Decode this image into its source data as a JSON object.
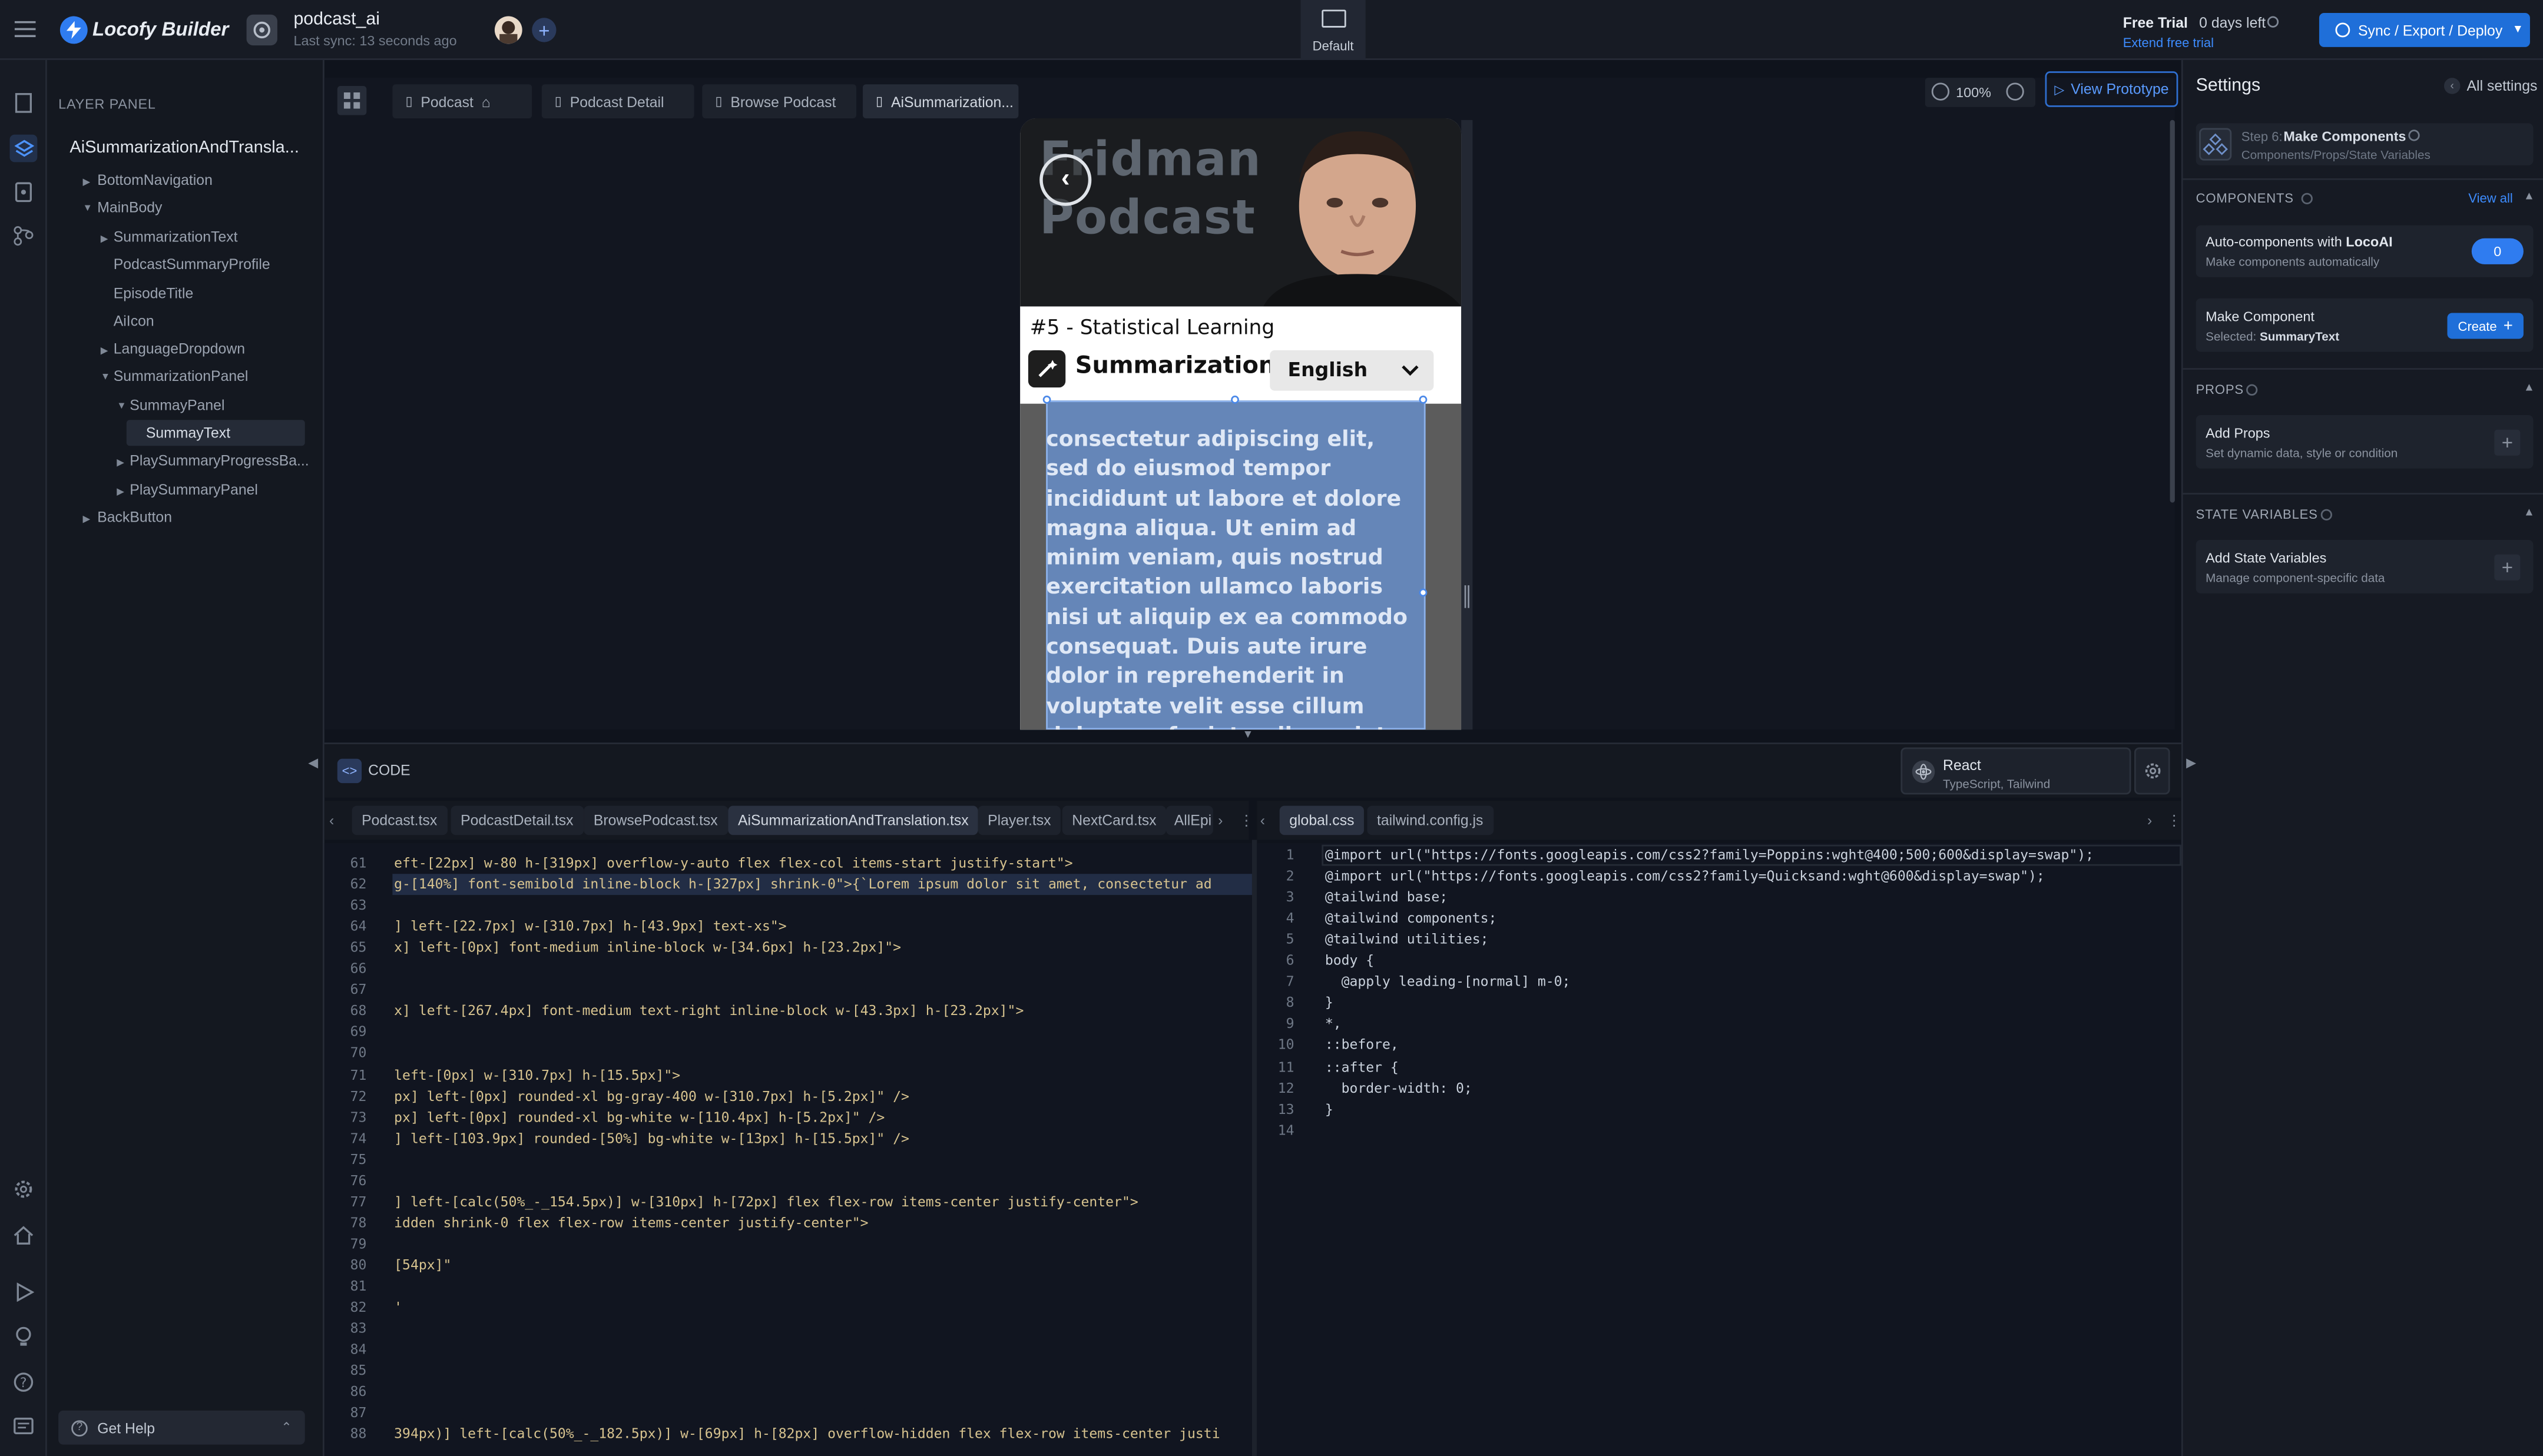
{
  "app": {
    "brand": "Locofy Builder",
    "project": "podcast_ai",
    "sync_status": "Last sync: 13 seconds ago",
    "device": "Default",
    "trial": "Free Trial",
    "days_left": "0 days left",
    "extend": "Extend free trial",
    "deploy": "Sync / Export / Deploy"
  },
  "layer_panel": {
    "title": "LAYER PANEL",
    "root": "AiSummarizationAndTransla...",
    "items": [
      "BottomNavigation",
      "MainBody",
      "SummarizationText",
      "PodcastSummaryProfile",
      "EpisodeTitle",
      "AiIcon",
      "LanguageDropdown",
      "SummarizationPanel",
      "SummayPanel",
      "SummayText",
      "PlaySummaryProgressBa...",
      "PlaySummaryPanel",
      "BackButton"
    ],
    "help": "Get Help"
  },
  "page_tabs": [
    "Podcast",
    "Podcast Detail",
    "Browse Podcast",
    "AiSummarization..."
  ],
  "zoom": "100%",
  "view_prototype": "View Prototype",
  "preview": {
    "header_line1": "Fridman",
    "header_line2": "Podcast",
    "episode": "#5 - Statistical Learning",
    "section": "Summarization",
    "language": "English",
    "body": "consectetur adipiscing elit, sed do eiusmod tempor incididunt ut labore et dolore magna aliqua. Ut enim ad minim veniam, quis nostrud exercitation ullamco laboris nisi ut aliquip ex ea commodo consequat. Duis aute irure dolor in reprehenderit in voluptate velit esse cillum dolore eu fugiat nulla pariatur. Excepteur"
  },
  "settings": {
    "title": "Settings",
    "all": "All settings",
    "step": "Step 6:",
    "step_title": "Make Components",
    "step_sub": "Components/Props/State Variables",
    "components_label": "COMPONENTS",
    "view_all": "View all",
    "auto_title_a": "Auto-components with ",
    "auto_title_b": "LocoAI",
    "auto_sub": "Make components automatically",
    "auto_count": "0",
    "make_title": "Make Component",
    "make_sub_a": "Selected: ",
    "make_sub_b": "SummaryText",
    "create": "Create",
    "props_label": "PROPS",
    "props_title": "Add Props",
    "props_sub": "Set dynamic data, style or condition",
    "state_label": "STATE VARIABLES",
    "state_title": "Add State Variables",
    "state_sub": "Manage component-specific data"
  },
  "code": {
    "label": "CODE",
    "framework": "React",
    "framework_sub": "TypeScript, Tailwind",
    "left_tabs": [
      "Podcast.tsx",
      "PodcastDetail.tsx",
      "BrowsePodcast.tsx",
      "AiSummarizationAndTranslation.tsx",
      "Player.tsx",
      "NextCard.tsx",
      "AllEpi"
    ],
    "right_tabs": [
      "global.css",
      "tailwind.config.js"
    ],
    "left_lines": [
      {
        "n": "61",
        "t": "eft-[22px] w-80 h-[319px] overflow-y-auto flex flex-col items-start justify-start\">"
      },
      {
        "n": "62",
        "t": "g-[140%] font-semibold inline-block h-[327px] shrink-0\">{`Lorem ipsum dolor sit amet, consectetur ad"
      },
      {
        "n": "63",
        "t": ""
      },
      {
        "n": "64",
        "t": "] left-[22.7px] w-[310.7px] h-[43.9px] text-xs\">"
      },
      {
        "n": "65",
        "t": "x] left-[0px] font-medium inline-block w-[34.6px] h-[23.2px]\">"
      },
      {
        "n": "66",
        "t": ""
      },
      {
        "n": "67",
        "t": ""
      },
      {
        "n": "68",
        "t": "x] left-[267.4px] font-medium text-right inline-block w-[43.3px] h-[23.2px]\">"
      },
      {
        "n": "69",
        "t": ""
      },
      {
        "n": "70",
        "t": ""
      },
      {
        "n": "71",
        "t": "left-[0px] w-[310.7px] h-[15.5px]\">"
      },
      {
        "n": "72",
        "t": "px] left-[0px] rounded-xl bg-gray-400 w-[310.7px] h-[5.2px]\" />"
      },
      {
        "n": "73",
        "t": "px] left-[0px] rounded-xl bg-white w-[110.4px] h-[5.2px]\" />"
      },
      {
        "n": "74",
        "t": "] left-[103.9px] rounded-[50%] bg-white w-[13px] h-[15.5px]\" />"
      },
      {
        "n": "75",
        "t": ""
      },
      {
        "n": "76",
        "t": ""
      },
      {
        "n": "77",
        "t": "] left-[calc(50%_-_154.5px)] w-[310px] h-[72px] flex flex-row items-center justify-center\">"
      },
      {
        "n": "78",
        "t": "idden shrink-0 flex flex-row items-center justify-center\">"
      },
      {
        "n": "79",
        "t": ""
      },
      {
        "n": "80",
        "t": "[54px]\""
      },
      {
        "n": "81",
        "t": ""
      },
      {
        "n": "82",
        "t": "'"
      },
      {
        "n": "83",
        "t": ""
      },
      {
        "n": "84",
        "t": ""
      },
      {
        "n": "85",
        "t": ""
      },
      {
        "n": "86",
        "t": ""
      },
      {
        "n": "87",
        "t": ""
      },
      {
        "n": "88",
        "t": "394px)] left-[calc(50%_-_182.5px)] w-[69px] h-[82px] overflow-hidden flex flex-row items-center justi"
      }
    ],
    "right_lines": [
      {
        "n": "1",
        "t": "@import url(\"https://fonts.googleapis.com/css2?family=Poppins:wght@400;500;600&display=swap\");"
      },
      {
        "n": "2",
        "t": "@import url(\"https://fonts.googleapis.com/css2?family=Quicksand:wght@600&display=swap\");"
      },
      {
        "n": "3",
        "t": "@tailwind base;"
      },
      {
        "n": "4",
        "t": "@tailwind components;"
      },
      {
        "n": "5",
        "t": "@tailwind utilities;"
      },
      {
        "n": "6",
        "t": "body {"
      },
      {
        "n": "7",
        "t": "  @apply leading-[normal] m-0;"
      },
      {
        "n": "8",
        "t": "}"
      },
      {
        "n": "9",
        "t": "*,"
      },
      {
        "n": "10",
        "t": "::before,"
      },
      {
        "n": "11",
        "t": "::after {"
      },
      {
        "n": "12",
        "t": "  border-width: 0;"
      },
      {
        "n": "13",
        "t": "}"
      },
      {
        "n": "14",
        "t": ""
      }
    ]
  },
  "colors": {
    "accent": "#1f6fd9",
    "selection": "#4a6fa5",
    "bg": "#0f131c"
  }
}
